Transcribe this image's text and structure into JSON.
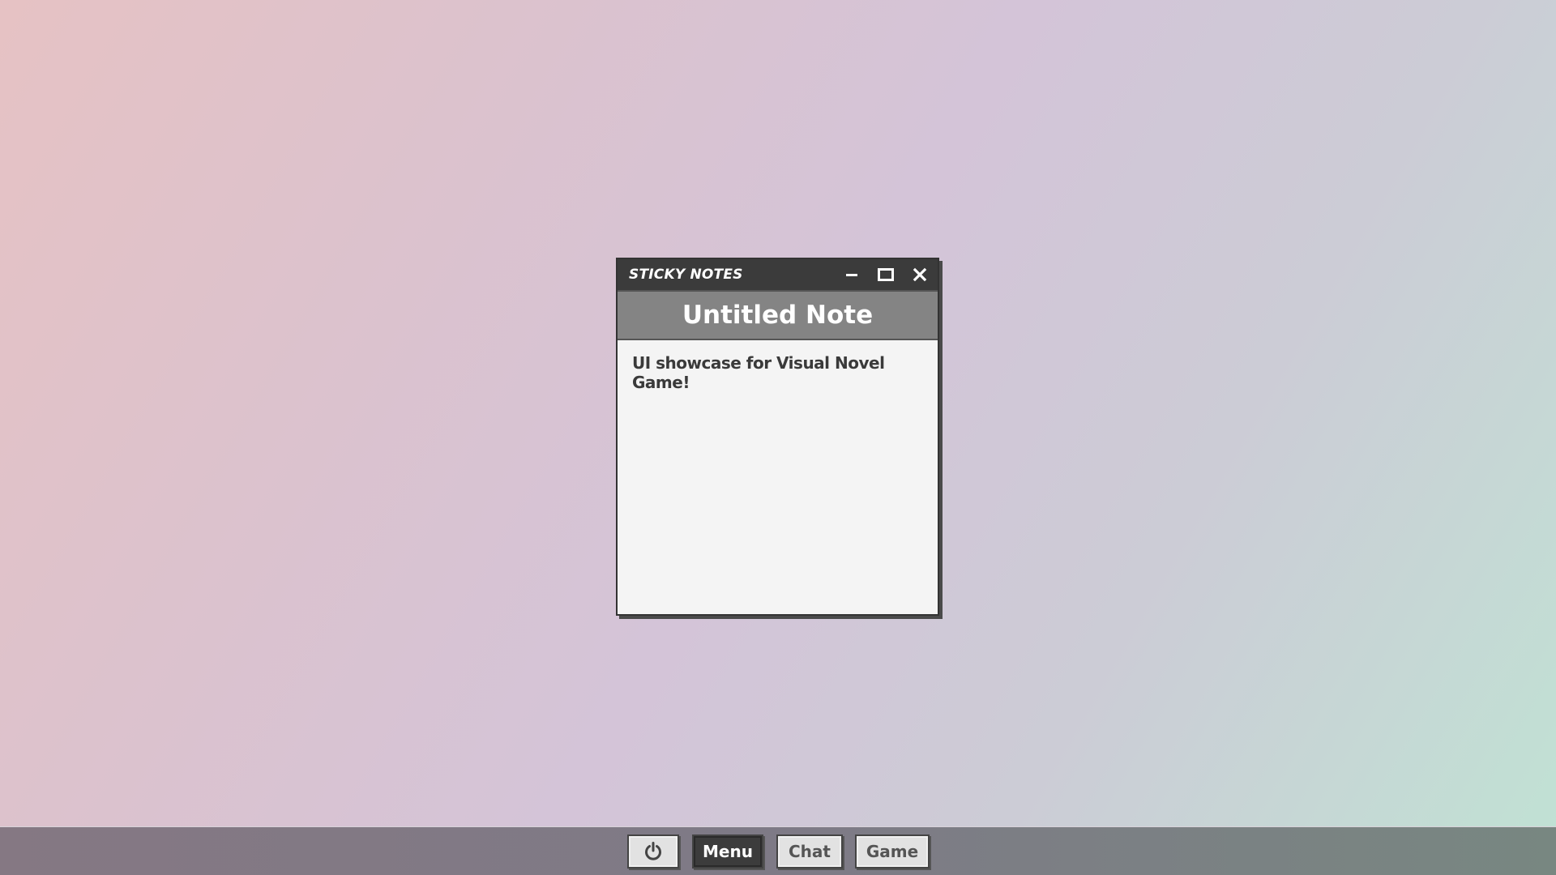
{
  "window": {
    "title": "STICKY NOTES",
    "controls": {
      "minimize_icon": "minimize-icon",
      "maximize_icon": "maximize-icon",
      "close_icon": "close-icon"
    }
  },
  "note": {
    "title": "Untitled Note",
    "content": "UI showcase for Visual Novel Game!"
  },
  "taskbar": {
    "power_icon": "power-icon",
    "buttons": [
      {
        "label": "Menu",
        "active": true
      },
      {
        "label": "Chat",
        "active": false
      },
      {
        "label": "Game",
        "active": false
      }
    ]
  },
  "colors": {
    "titlebar": "#3b3b3b",
    "note_header": "#848484",
    "note_body": "#f4f4f4",
    "active_button": "#3c3c3c"
  }
}
